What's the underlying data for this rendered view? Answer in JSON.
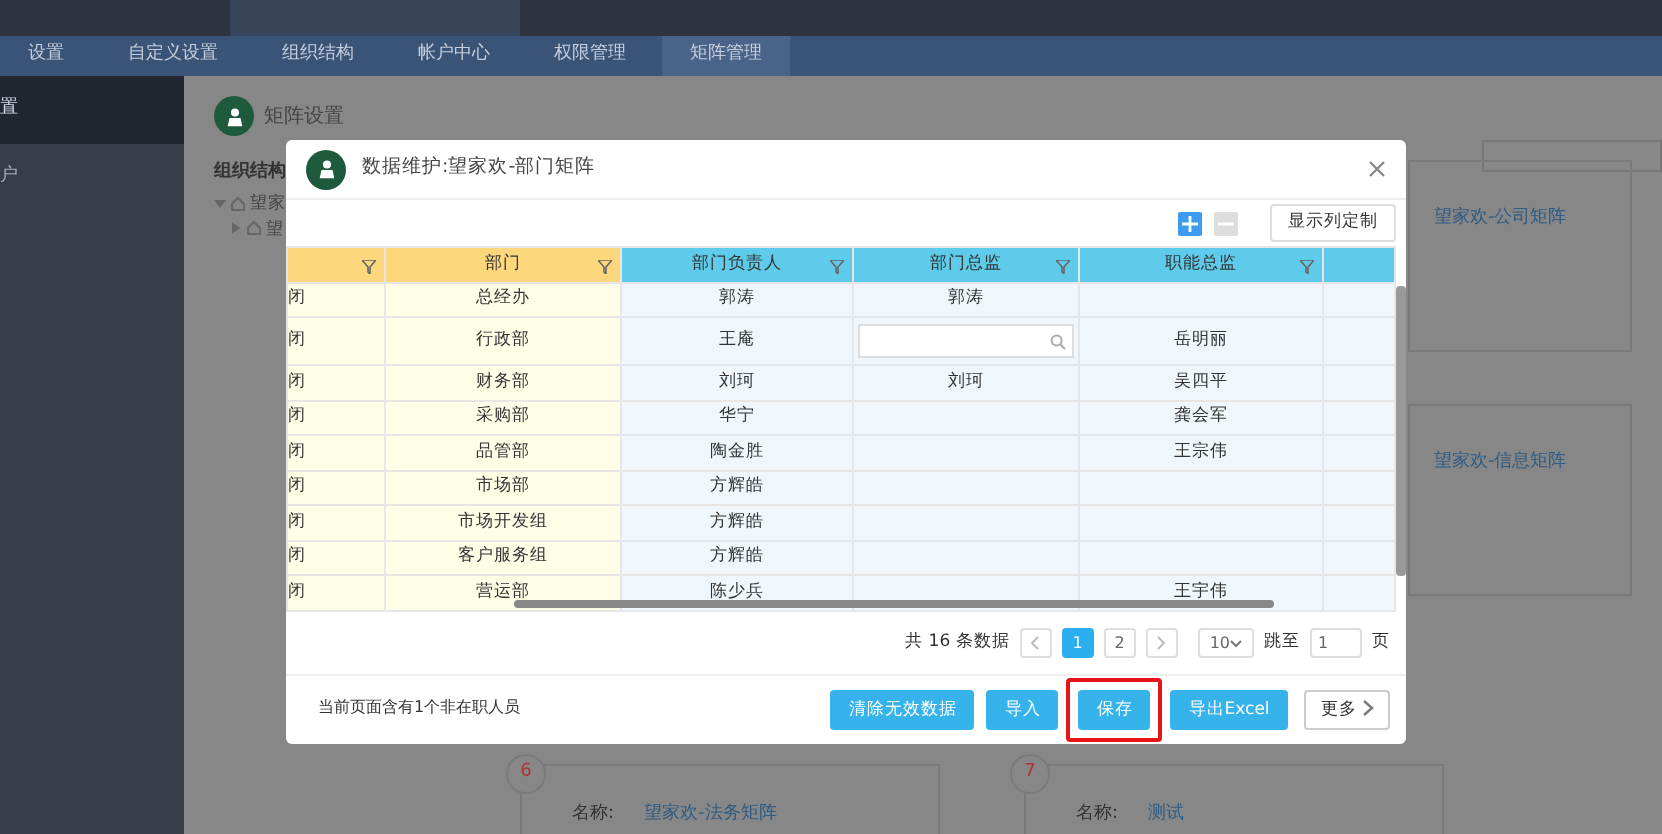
{
  "top_nav": {
    "items": [
      {
        "label": "设置",
        "selected": false
      },
      {
        "label": "自定义设置",
        "selected": false
      },
      {
        "label": "组织结构",
        "selected": false
      },
      {
        "label": "帐户中心",
        "selected": false
      },
      {
        "label": "权限管理",
        "selected": false
      },
      {
        "label": "矩阵管理",
        "selected": true
      }
    ]
  },
  "sidebar": {
    "items": [
      {
        "label": "置",
        "selected": true
      },
      {
        "label": "户",
        "selected": false
      }
    ]
  },
  "page": {
    "title": "矩阵设置",
    "org_label": "组织结构",
    "tree": [
      {
        "label": "望家",
        "expanded": true,
        "children": [
          {
            "label": "望",
            "expanded": false
          }
        ]
      }
    ],
    "side_cards": [
      {
        "name": "望家欢-公司矩阵"
      },
      {
        "name": "望家欢-信息矩阵"
      }
    ],
    "bottom_cards": [
      {
        "number": "6",
        "label": "名称:",
        "name": "望家欢-法务矩阵"
      },
      {
        "number": "7",
        "label": "名称:",
        "name": "测试"
      }
    ]
  },
  "dialog": {
    "title": "数据维护:望家欢-部门矩阵",
    "column_settings": "显示列定制",
    "columns": [
      {
        "frozen": true
      },
      {
        "label": "部门",
        "frozen": true
      },
      {
        "label": "部门负责人",
        "frozen": false
      },
      {
        "label": "部门总监",
        "frozen": false
      },
      {
        "label": "职能总监",
        "frozen": false
      }
    ],
    "rows": [
      {
        "cells": [
          {
            "kind": "text",
            "text": "闭"
          },
          {
            "kind": "text",
            "text": "总经办"
          },
          {
            "kind": "text",
            "text": "郭涛"
          },
          {
            "kind": "text",
            "text": "郭涛"
          },
          {
            "kind": "empty"
          }
        ]
      },
      {
        "cells": [
          {
            "kind": "text",
            "text": "闭"
          },
          {
            "kind": "text",
            "text": "行政部"
          },
          {
            "kind": "text",
            "text": "王庵"
          },
          {
            "kind": "search"
          },
          {
            "kind": "text",
            "text": "岳明丽"
          }
        ]
      },
      {
        "cells": [
          {
            "kind": "text",
            "text": "闭"
          },
          {
            "kind": "text",
            "text": "财务部"
          },
          {
            "kind": "text",
            "text": "刘珂"
          },
          {
            "kind": "text",
            "text": "刘珂"
          },
          {
            "kind": "text",
            "text": "吴四平"
          }
        ]
      },
      {
        "cells": [
          {
            "kind": "text",
            "text": "闭"
          },
          {
            "kind": "text",
            "text": "采购部"
          },
          {
            "kind": "text",
            "text": "华宁"
          },
          {
            "kind": "empty"
          },
          {
            "kind": "text",
            "text": "龚会军"
          }
        ]
      },
      {
        "cells": [
          {
            "kind": "text",
            "text": "闭"
          },
          {
            "kind": "text",
            "text": "品管部"
          },
          {
            "kind": "text",
            "text": "陶金胜"
          },
          {
            "kind": "empty"
          },
          {
            "kind": "text",
            "text": "王宗伟"
          }
        ]
      },
      {
        "cells": [
          {
            "kind": "text",
            "text": "闭"
          },
          {
            "kind": "text",
            "text": "市场部"
          },
          {
            "kind": "text",
            "text": "方辉皓"
          },
          {
            "kind": "empty"
          },
          {
            "kind": "empty"
          }
        ]
      },
      {
        "cells": [
          {
            "kind": "text",
            "text": "闭"
          },
          {
            "kind": "text",
            "text": "市场开发组"
          },
          {
            "kind": "text",
            "text": "方辉皓"
          },
          {
            "kind": "empty"
          },
          {
            "kind": "empty"
          }
        ]
      },
      {
        "cells": [
          {
            "kind": "text",
            "text": "闭"
          },
          {
            "kind": "text",
            "text": "客户服务组"
          },
          {
            "kind": "text",
            "text": "方辉皓"
          },
          {
            "kind": "empty"
          },
          {
            "kind": "empty"
          }
        ]
      },
      {
        "cells": [
          {
            "kind": "text",
            "text": "闭"
          },
          {
            "kind": "text",
            "text": "营运部"
          },
          {
            "kind": "text",
            "text": "陈少兵"
          },
          {
            "kind": "empty"
          },
          {
            "kind": "text",
            "text": "王宇伟"
          }
        ]
      }
    ],
    "pagination": {
      "summary": "共 16 条数据",
      "pages": [
        {
          "label": "1",
          "selected": true
        },
        {
          "label": "2",
          "selected": false
        }
      ],
      "page_size": "10",
      "jump_label": "跳至",
      "jump_value": "1",
      "page_unit": "页"
    },
    "footer_note": "当前页面含有1个非在职人员",
    "buttons": [
      {
        "kind": "primary",
        "label": "清除无效数据",
        "highlighted": false
      },
      {
        "kind": "primary",
        "label": "导入",
        "highlighted": false
      },
      {
        "kind": "primary",
        "label": "保存",
        "highlighted": true
      },
      {
        "kind": "primary",
        "label": "导出Excel",
        "highlighted": false
      },
      {
        "kind": "more",
        "label": "更多",
        "highlighted": false
      }
    ]
  }
}
